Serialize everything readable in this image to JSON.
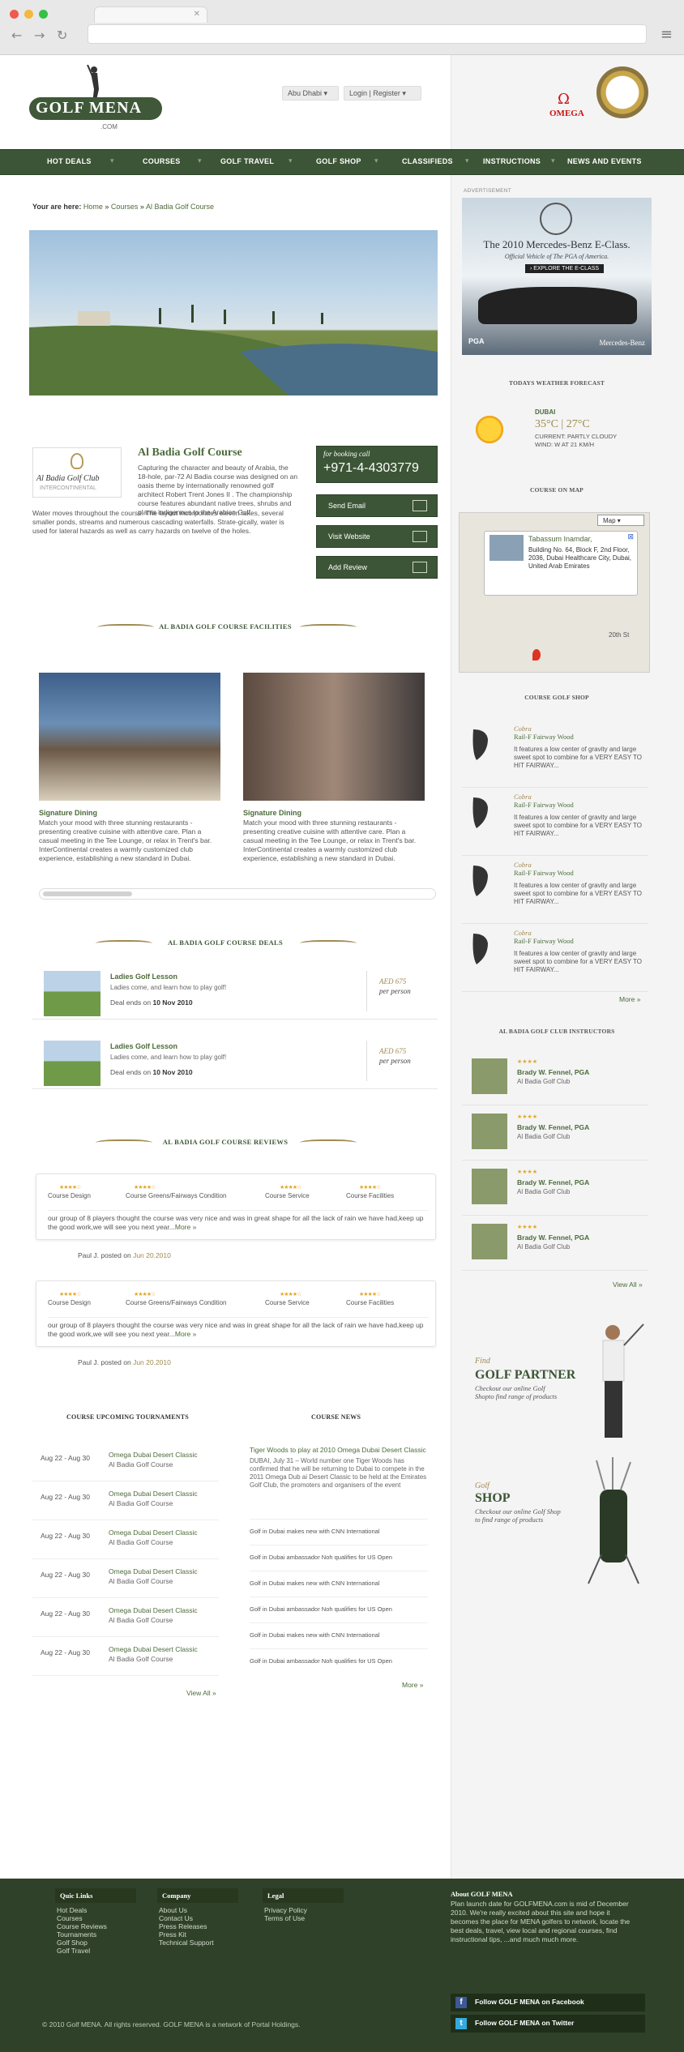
{
  "nav": {
    "items": [
      "HOT DEALS",
      "COURSES",
      "GOLF TRAVEL",
      "GOLF SHOP",
      "CLASSIFIEDS",
      "INSTRUCTIONS",
      "NEWS AND EVENTS"
    ]
  },
  "header": {
    "logo_text": "GOLF MENA",
    "logo_suffix": ".COM",
    "location": "Abu Dhabi",
    "login": "Login | Register",
    "sponsor": "OMEGA"
  },
  "breadcrumb": {
    "prefix": "Your are here:",
    "home": "Home",
    "courses": "Courses",
    "current": "Al Badia Golf Course"
  },
  "course": {
    "club_logo_name": "Al Badia Golf Club",
    "club_logo_sub": "INTERCONTINENTAL",
    "title": "Al Badia Golf Course",
    "desc1": "Capturing the character and beauty of Arabia, the 18-hole, par-72 Al Badia course was designed on an oasis theme by internationally renowned golf architect Robert Trent Jones II . The championship course features abundant native trees, shrubs and plants indigenous to the Arabian Gulf.",
    "desc2": "Water moves throughout the course. The layout incorporates eleven lakes, several smaller ponds, streams and numerous cascading waterfalls. Strate-gically, water is used for lateral hazards as well as carry hazards on twelve of the holes.",
    "booking_label": "for booking call",
    "booking_phone": "+971-4-4303779",
    "send_email": "Send Email",
    "visit_website": "Visit Website",
    "add_review": "Add Review"
  },
  "facilities": {
    "heading": "AL BADIA GOLF COURSE FACILITIES",
    "items": [
      {
        "title": "Signature Dining",
        "desc": "Match your mood with three stunning restaurants - presenting creative cuisine with attentive care. Plan a casual meeting in the Tee Lounge, or relax in Trent's bar. InterContinental creates a warmly customized club experience, establishing a new standard in Dubai."
      },
      {
        "title": "Signature Dining",
        "desc": "Match your mood with three stunning restaurants - presenting creative cuisine with attentive care. Plan a casual meeting in the Tee Lounge, or relax in Trent's bar. InterContinental creates a warmly customized club experience, establishing a new standard in Dubai."
      }
    ]
  },
  "deals": {
    "heading": "AL BADIA GOLF COURSE DEALS",
    "items": [
      {
        "title": "Ladies Golf Lesson",
        "desc": "Ladies come, and learn how to play golf!",
        "ends_label": "Deal ends on",
        "ends": "10 Nov 2010",
        "price": "AED 675",
        "per": "per person"
      },
      {
        "title": "Ladies Golf Lesson",
        "desc": "Ladies come, and learn how to play golf!",
        "ends_label": "Deal ends on",
        "ends": "10 Nov 2010",
        "price": "AED 675",
        "per": "per person"
      }
    ]
  },
  "reviews": {
    "heading": "AL BADIA GOLF COURSE REVIEWS",
    "criteria": [
      "Course Design",
      "Course Greens/Fairways Condition",
      "Course Service",
      "Course Facilities"
    ],
    "rating_stars": "★★★★☆",
    "items": [
      {
        "text": "our group of 8 players thought the course was very nice and was in great shape for all the lack of rain we have had,keep up the good work,we will see you next year...",
        "more": "More »",
        "author": "Paul J. posted on",
        "date": "Jun 20.2010"
      },
      {
        "text": "our group of 8 players thought the course was very nice and was in great shape for all the lack of rain we have had,keep up the good work,we will see you next year...",
        "more": "More »",
        "author": "Paul J. posted on",
        "date": "Jun 20.2010"
      }
    ]
  },
  "tournaments": {
    "heading": "COURSE UPCOMING TOURNAMENTS",
    "items": [
      {
        "date": "Aug 22 - Aug 30",
        "name": "Omega Dubai Desert Classic",
        "course": "Al Badia Golf Course"
      },
      {
        "date": "Aug 22 - Aug 30",
        "name": "Omega Dubai Desert Classic",
        "course": "Al Badia Golf Course"
      },
      {
        "date": "Aug 22 - Aug 30",
        "name": "Omega Dubai Desert Classic",
        "course": "Al Badia Golf Course"
      },
      {
        "date": "Aug 22 - Aug 30",
        "name": "Omega Dubai Desert Classic",
        "course": "Al Badia Golf Course"
      },
      {
        "date": "Aug 22 - Aug 30",
        "name": "Omega Dubai Desert Classic",
        "course": "Al Badia Golf Course"
      },
      {
        "date": "Aug 22 - Aug 30",
        "name": "Omega Dubai Desert Classic",
        "course": "Al Badia Golf Course"
      }
    ],
    "view_all": "View All »"
  },
  "news": {
    "heading": "COURSE NEWS",
    "featured_title": "Tiger Woods to play at 2010 Omega Dubai Desert Classic",
    "featured_desc": "DUBAI, July 31 – World number one Tiger Woods has confirmed that he will be returning to Dubai to compete in the 2011 Omega Dub ai Desert Classic to be held at the Emirates Golf Club, the promoters and organisers of the event",
    "items": [
      "Golf in Dubai makes new with CNN International",
      "Golf in Dubai ambassador Noh qualifies for US Open",
      "Golf in Dubai makes new with CNN International",
      "Golf in Dubai ambassador Noh qualifies for US Open",
      "Golf in Dubai makes new with CNN International",
      "Golf in Dubai ambassador Noh qualifies for US Open"
    ],
    "more": "More »"
  },
  "sidebar": {
    "ad_label": "ADVERTISEMENT",
    "ad_title": "The 2010 Mercedes-Benz E-Class.",
    "ad_sub": "Official Vehicle of The PGA of America.",
    "ad_cta": "› EXPLORE THE E-CLASS",
    "ad_brand": "Mercedes-Benz",
    "ad_pga": "PGA",
    "weather_heading": "TODAYS WEATHER FORECAST",
    "weather_city": "DUBAI",
    "weather_temp": "35°C | 27°C",
    "weather_current": "CURRENT: PARTLY CLOUDY",
    "weather_wind": "WIND: W AT 21 KM/H",
    "map_heading": "COURSE ON MAP",
    "map_select": "Map",
    "map_name": "Tabassum Inamdar,",
    "map_addr": "Building No. 64, Block F, 2nd Floor, 2036, Dubai Healthcare City, Dubai, United Arab Emirates",
    "map_street": "20th St",
    "shop_heading": "COURSE GOLF SHOP",
    "shop_items": [
      {
        "brand": "Cobra",
        "name": "Rail-F Fairway Wood",
        "desc": "It features a low center of gravity and large sweet spot to combine for a VERY EASY TO HIT FAIRWAY..."
      },
      {
        "brand": "Cobra",
        "name": "Rail-F Fairway Wood",
        "desc": "It features a low center of gravity and large sweet spot to combine for a VERY EASY TO HIT FAIRWAY..."
      },
      {
        "brand": "Cobra",
        "name": "Rail-F Fairway Wood",
        "desc": "It features a low center of gravity and large sweet spot to combine for a VERY EASY TO HIT FAIRWAY..."
      },
      {
        "brand": "Cobra",
        "name": "Rail-F Fairway Wood",
        "desc": "It features a low center of gravity and large sweet spot to combine for a VERY EASY TO HIT FAIRWAY..."
      }
    ],
    "shop_more": "More »",
    "instr_heading": "AL BADIA GOLF CLUB INSTRUCTORS",
    "instructors": [
      {
        "stars": "★★★★",
        "name": "Brady W. Fennel, PGA",
        "club": "Al Badia Golf Club"
      },
      {
        "stars": "★★★★",
        "name": "Brady W. Fennel, PGA",
        "club": "Al Badia Golf Club"
      },
      {
        "stars": "★★★★",
        "name": "Brady W. Fennel, PGA",
        "club": "Al Badia Golf Club"
      },
      {
        "stars": "★★★★",
        "name": "Brady W. Fennel, PGA",
        "club": "Al Badia Golf Club"
      }
    ],
    "instr_view_all": "View All »",
    "partner_find": "Find",
    "partner_title": "GOLF PARTNER",
    "partner_desc": "Checkout our online Golf Shopto find range of products",
    "shop_golf": "Golf",
    "shop_title": "SHOP",
    "shop_desc": "Checkout our online Golf Shop to find range of products"
  },
  "footer": {
    "col1_title": "Quic Links",
    "col1": [
      "Hot Deals",
      "Courses",
      "Course Reviews",
      "Tournaments",
      "Golf Shop",
      "Golf Travel"
    ],
    "col2_title": "Company",
    "col2": [
      "About Us",
      "Contact Us",
      "Press Releases",
      "Press Kit",
      "Technical Support"
    ],
    "col3_title": "Legal",
    "col3": [
      "Privacy Policy",
      "Terms of Use"
    ],
    "about_title": "About GOLF MENA",
    "about_desc": "Plan launch date for GOLFMENA.com is mid of December 2010. We're really excited about this site and hope it becomes the place for MENA golfers to network, locate the best deals, travel, view local and regional courses, find instructional tips, ...and much much more.",
    "copyright": "© 2010 Golf MENA. All rights reserved. GOLF MENA is a network of Portal Holdings.",
    "facebook": "Follow GOLF MENA on Facebook",
    "twitter": "Follow GOLF MENA on Twitter"
  }
}
